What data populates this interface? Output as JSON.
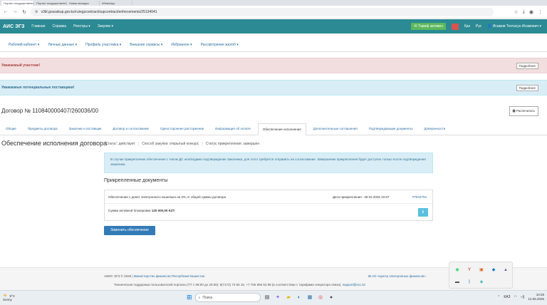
{
  "browser": {
    "tabs": [
      {
        "label": "Портал государственных зак..."
      },
      {
        "label": "Портал государственных зак..."
      },
      {
        "label": "Новая вкладка"
      },
      {
        "label": "WhatsApp"
      }
    ],
    "url": "v3bl.goszakup.gov.kz/ru/egzcontract/supcontract/enforcements/25134041"
  },
  "header": {
    "logo": "АИС ЭГЗ",
    "nav": [
      "Главная",
      "Справка",
      "Реестры ▾",
      "Закупки ▾"
    ],
    "tariff": "Тариф активен",
    "lang": [
      "Қаз",
      "Рус"
    ],
    "user": "Исамов Тохтасун Исамович ▾"
  },
  "submenu": [
    "Рабочий кабинет ▾",
    "Личные данные ▾",
    "Профиль участника ▾",
    "Внешние сервисы ▾",
    "Избранное ▾",
    "Рассмотрение жалоб ▾"
  ],
  "alerts": {
    "danger_text": "Уважаемый участник!",
    "info_text": "Уважаемые потенциальные поставщики!",
    "more_label": "Подробнее"
  },
  "contract": {
    "title": "Договор № 110840000407/260036/00",
    "print_label": "Распечатать"
  },
  "tabs": [
    {
      "label": "Общие",
      "active": false
    },
    {
      "label": "Предметы договора",
      "active": false
    },
    {
      "label": "Заказчик и поставщик",
      "active": false
    },
    {
      "label": "Договор и согласование",
      "active": false
    },
    {
      "label": "Одностороннее расторжение",
      "active": false
    },
    {
      "label": "Информация об оплате",
      "active": false
    },
    {
      "label": "Обеспечение исполнения",
      "active": true
    },
    {
      "label": "Дополнительные соглашения",
      "active": false
    },
    {
      "label": "Подтверждающие документы",
      "active": false
    },
    {
      "label": "Доверенности",
      "active": false
    }
  ],
  "section": {
    "title": "Обеспечение исполнения договора",
    "status": "Статус: действует",
    "method": "Способ закупки: открытый конкурс",
    "attach_status": "Статус прикрепления: завершен"
  },
  "notice": "В случае прикрепления обеспечения с типом ДС необходимо подтверждение Заказчика, для этого требуется отправить на согласование. Завершение прикрепления будет доступно только после подтверждения заказчика.",
  "docs": {
    "title": "Прикрепленные документы",
    "name": "Обеспечение с денег электронного кошелька на 3% от общей суммы договора",
    "date_label": "Дата прикрепления : 29.04.2026 10:57",
    "link": "#7844794",
    "amount_label": "Сумма активной блокировки",
    "amount_value": "120 000,00 KZT"
  },
  "replace_label": "Заменить обеспечение",
  "footer": {
    "copy": "АИИС ЭГЗ © 2026 |",
    "ministry": "Министерство финансов Республики Казахстан",
    "center": "АО «Центр электронных финансов»",
    "support": "Техническая поддержка пользователей портала (7/7 с 08:00 до 20:00): 8(7172) 73 55 15, +7 705 956 53 88 (в соответствии с тарифами оператора связи),",
    "email": "support@ecc.kz"
  },
  "taskbar": {
    "temp": "9°C",
    "weather": "Sunny",
    "search": "Поиск",
    "lang": "КАЗ",
    "time": "10:28",
    "date": "12.05.2026"
  }
}
